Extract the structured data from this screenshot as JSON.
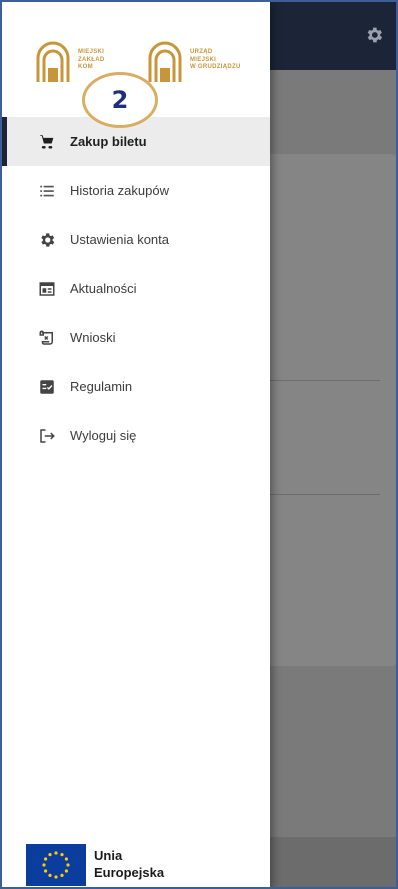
{
  "colors": {
    "topbar": "#1b2537",
    "logo_gold": "#c8963a",
    "badge_ring": "#d9ad63",
    "badge_text": "#1c2f7a",
    "active_marker": "#1b2537",
    "eu_blue": "#0a3d9e",
    "eu_star": "#ffcc00"
  },
  "topbar": {
    "settings_icon": "gear-icon"
  },
  "logos": {
    "left": {
      "text": "MIEJSKI\nZAKŁAD\nKOM",
      "icon": "arch-logo-icon"
    },
    "right": {
      "text": "URZĄD\nMIEJSKI\nW GRUDZIĄDZU",
      "icon": "arch-logo-icon"
    }
  },
  "step_badge": {
    "number": "2"
  },
  "menu": {
    "items": [
      {
        "label": "Zakup biletu",
        "icon": "cart-icon",
        "active": true
      },
      {
        "label": "Historia zakupów",
        "icon": "list-icon",
        "active": false
      },
      {
        "label": "Ustawienia konta",
        "icon": "gear-icon",
        "active": false
      },
      {
        "label": "Aktualności",
        "icon": "newspaper-icon",
        "active": false
      },
      {
        "label": "Wnioski",
        "icon": "document-scroll-icon",
        "active": false
      },
      {
        "label": "Regulamin",
        "icon": "checklist-icon",
        "active": false
      },
      {
        "label": "Wyloguj się",
        "icon": "logout-icon",
        "active": false
      }
    ]
  },
  "footer": {
    "eu_line1": "Unia",
    "eu_line2": "Europejska",
    "flag_icon": "eu-flag-icon"
  }
}
